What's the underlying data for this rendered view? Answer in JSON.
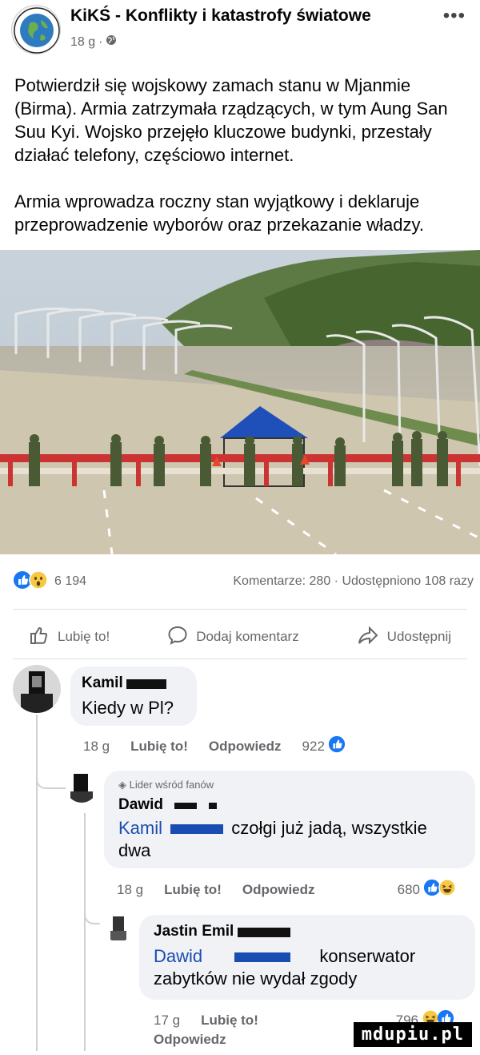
{
  "post": {
    "page_name": "KiKŚ - Konflikty i katastrofy światowe",
    "time": "18 g",
    "separator": "·",
    "paragraphs": [
      "Potwierdził się wojskowy zamach stanu w Mjanmie (Birma). Armia zatrzymała rządzących, w tym Aung San Suu Kyi. Wojsko przejęło kluczowe budynki, przestały działać telefony, częściowo internet.",
      "Armia wprowadza roczny stan wyjątkowy i deklaruje przeprowadzenie wyborów oraz przekazanie władzy."
    ],
    "reaction_count": "6 194",
    "counts_text": "Komentarze: 280 · Udostępniono 108 razy"
  },
  "actions": {
    "like": "Lubię to!",
    "comment": "Dodaj komentarz",
    "share": "Udostępnij"
  },
  "comments": [
    {
      "name": "Kamil",
      "text": "Kiedy w Pl?",
      "time": "18 g",
      "like": "Lubię to!",
      "reply": "Odpowiedz",
      "reactions": "922"
    },
    {
      "badge": "Lider wśród fanów",
      "name": "Dawid",
      "mention": "Kamil",
      "text": "czołgi już jadą, wszystkie dwa",
      "time": "18 g",
      "like": "Lubię to!",
      "reply": "Odpowiedz",
      "reactions": "680"
    },
    {
      "name": "Jastin Emil",
      "mention": "Dawid",
      "text_after_mention": "konserwator",
      "text": "zabytków nie wydał zgody",
      "time": "17 g",
      "like": "Lubię to!",
      "reply": "Odpowiedz",
      "reactions": "796"
    }
  ],
  "watermark": "mdupiu.pl",
  "colors": {
    "facebook_blue": "#1877f2",
    "mention": "#1a4db2",
    "secondary_text": "#65676b",
    "bubble": "#f0f2f5"
  }
}
